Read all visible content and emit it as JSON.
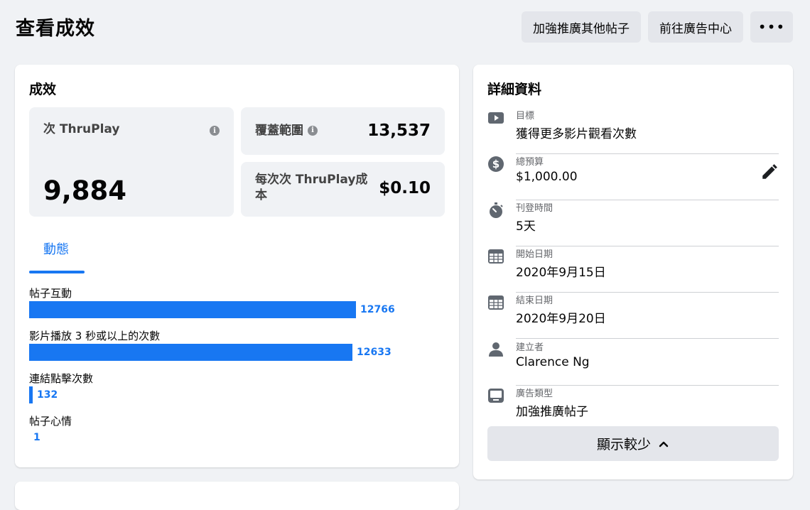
{
  "header": {
    "title": "查看成效",
    "boost_other_label": "加強推廣其他帖子",
    "ads_center_label": "前往廣告中心",
    "more_label": "•••"
  },
  "performance": {
    "title": "成效",
    "thruplay_label": "次 ThruPlay",
    "thruplay_value": "9,884",
    "reach_label": "覆蓋範圍",
    "reach_value": "13,537",
    "cost_label": "每次次 ThruPlay成本",
    "cost_value": "$0.10",
    "tab_label": "動態",
    "bars": [
      {
        "label": "帖子互動",
        "value": 12766
      },
      {
        "label": "影片播放 3 秒或以上的次數",
        "value": 12633
      },
      {
        "label": "連結點擊次數",
        "value": 132
      },
      {
        "label": "帖子心情",
        "value": 1
      }
    ],
    "bar_max": 12766
  },
  "details": {
    "title": "詳細資料",
    "items": [
      {
        "label": "目標",
        "value": "獲得更多影片觀看次數",
        "icon": "video-play-icon"
      },
      {
        "label": "總預算",
        "value": "$1,000.00",
        "icon": "dollar-icon"
      },
      {
        "label": "刊登時間",
        "value": "5天",
        "icon": "stopwatch-icon"
      },
      {
        "label": "開始日期",
        "value": "2020年9月15日",
        "icon": "calendar-icon"
      },
      {
        "label": "結束日期",
        "value": "2020年9月20日",
        "icon": "calendar-icon"
      },
      {
        "label": "建立者",
        "value": "Clarence Ng",
        "icon": "person-icon"
      },
      {
        "label": "廣告類型",
        "value": "加強推廣帖子",
        "icon": "ad-type-icon"
      }
    ],
    "show_less_label": "顯示較少"
  },
  "colors": {
    "accent": "#1877f2",
    "icon_gray": "#606770"
  }
}
